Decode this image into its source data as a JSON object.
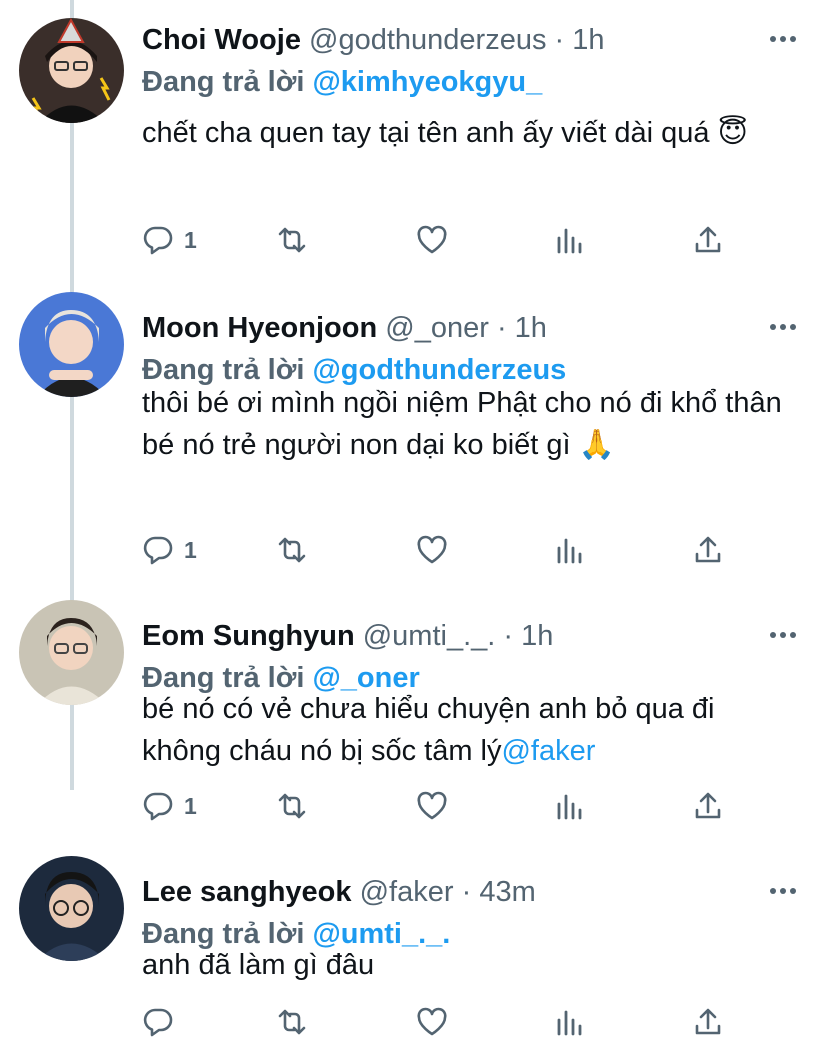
{
  "accent_color": "#1d9bf0",
  "tweets": [
    {
      "name": "Choi Wooje",
      "handle": "@godthunderzeus",
      "dot": "·",
      "time": "1h",
      "reply_prefix": "Đang trả lời ",
      "reply_to": "@kimhyeokgyu_",
      "text": "chết cha quen tay tại tên anh ấy viết dài quá 😇",
      "reply_count": "1",
      "avatar_icon": "avatar-choi-wooje"
    },
    {
      "name": "Moon Hyeonjoon",
      "handle": "@_oner",
      "dot": "·",
      "time": "1h",
      "reply_prefix": "Đang trả lời ",
      "reply_to": "@godthunderzeus",
      "text": "thôi bé ơi mình ngồi niệm Phật cho nó đi khổ thân bé nó trẻ người non dại ko biết gì 🙏",
      "reply_count": "1",
      "avatar_icon": "avatar-moon-hyeonjoon"
    },
    {
      "name": "Eom Sunghyun",
      "handle": "@umti_._.",
      "dot": "·",
      "time": "1h",
      "reply_prefix": "Đang trả lời ",
      "reply_to": "@_oner",
      "text_plain": "bé nó có vẻ chưa hiểu chuyện anh bỏ qua đi không cháu nó bị sốc tâm lý",
      "text_mention": "@faker",
      "reply_count": "1",
      "avatar_icon": "avatar-eom-sunghyun"
    },
    {
      "name": "Lee sanghyeok",
      "handle": "@faker",
      "dot": "·",
      "time": "43m",
      "reply_prefix": "Đang trả lời ",
      "reply_to": "@umti_._.",
      "text": "anh đã làm gì đâu",
      "reply_count": "",
      "avatar_icon": "avatar-lee-sanghyeok"
    }
  ]
}
